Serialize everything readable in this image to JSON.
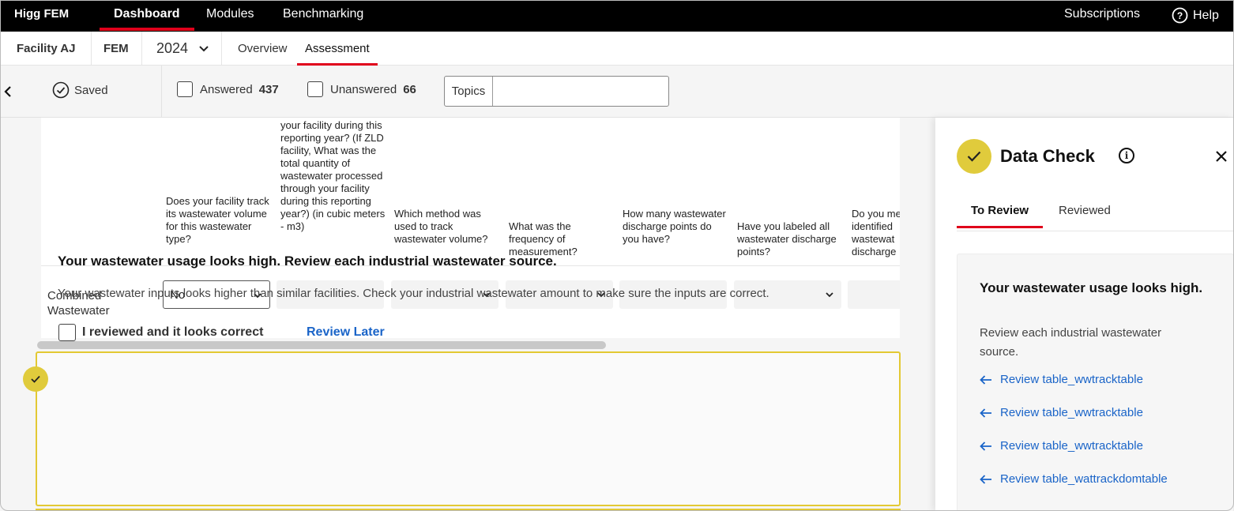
{
  "topnav": {
    "brand": "Higg FEM",
    "items": [
      "Dashboard",
      "Modules",
      "Benchmarking"
    ],
    "subscriptions": "Subscriptions",
    "help": "Help"
  },
  "subnav": {
    "facility": "Facility AJ",
    "module": "FEM",
    "year": "2024",
    "tabs": [
      "Overview",
      "Assessment"
    ]
  },
  "filterbar": {
    "saved": "Saved",
    "answered_label": "Answered",
    "answered_count": "437",
    "unanswered_label": "Unanswered",
    "unanswered_count": "66",
    "topics_label": "Topics",
    "topics_value": ""
  },
  "table": {
    "columns": [
      "Does your facility track its wastewater volume for this wastewater type?",
      "your facility during this reporting year? (If ZLD facility, What was the total quantity of wastewater processed through your facility during this reporting year?) (in cubic meters - m3)",
      "Which method was used to track wastewater volume?",
      "What was the frequency of measurement?",
      "How many wastewater discharge points do you have?",
      "Have you labeled all wastewater discharge points?",
      "Do you me identified wastewat discharge"
    ],
    "row_label": "Combined Wastewater",
    "row_value": "No"
  },
  "alert": {
    "title": "Your wastewater usage looks high. Review each industrial wastewater source.",
    "text": "Your wastewater inputs looks higher than similar facilities. Check your industrial wastewater amount to make sure the inputs are correct.",
    "checkbox_label": "I reviewed and it looks correct",
    "review_later": "Review Later"
  },
  "panel": {
    "title": "Data Check",
    "tabs": [
      "To Review",
      "Reviewed"
    ],
    "card_title": "Your wastewater usage looks high.",
    "card_text": "Review each industrial wastewater source.",
    "links": [
      "Review table_wwtracktable",
      "Review table_wwtracktable",
      "Review table_wwtracktable",
      "Review table_wattrackdomtable"
    ]
  },
  "colors": {
    "accent_red": "#e0001b",
    "check_yellow": "#e0cb3c",
    "link_blue": "#1a64c8"
  }
}
